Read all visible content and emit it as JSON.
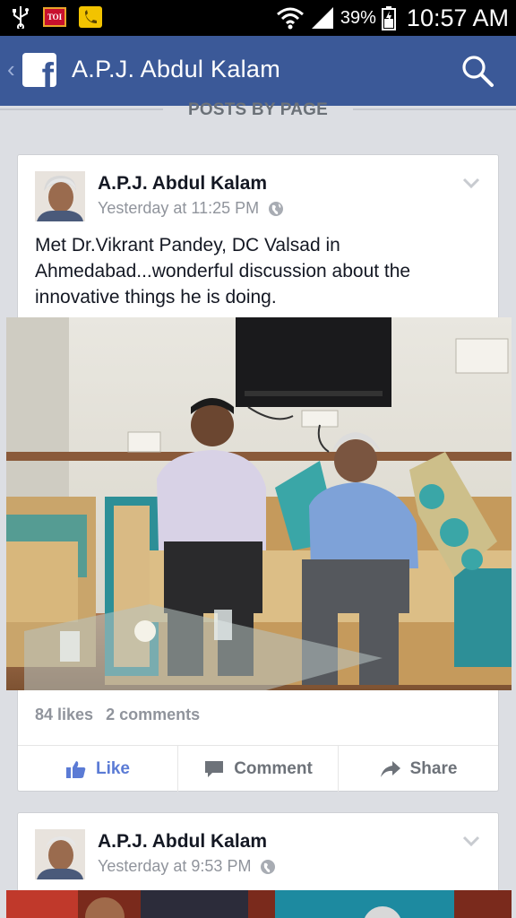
{
  "status_bar": {
    "battery": "39%",
    "time": "10:57 AM",
    "icons": [
      "usb-icon",
      "toi-app-icon",
      "call-app-icon",
      "wifi-icon",
      "signal-icon",
      "battery-icon"
    ],
    "toi_label": "TOI"
  },
  "app_bar": {
    "title": "A.P.J. Abdul Kalam",
    "logo_letter": "f",
    "color": "#3b5998"
  },
  "section": {
    "label": "POSTS BY PAGE"
  },
  "posts": [
    {
      "author": "A.P.J. Abdul Kalam",
      "time": "Yesterday at 11:25 PM",
      "text": "Met Dr.Vikrant Pandey, DC Valsad in Ahmedabad...wonderful discussion about the innovative things he is doing.",
      "likes": "84 likes",
      "comments": "2 comments",
      "actions": {
        "like": "Like",
        "comment": "Comment",
        "share": "Share"
      }
    },
    {
      "author": "A.P.J. Abdul Kalam",
      "time": "Yesterday at 9:53 PM"
    }
  ]
}
